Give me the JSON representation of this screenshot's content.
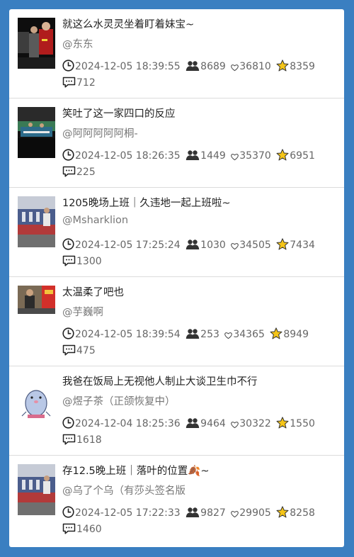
{
  "feed": {
    "items": [
      {
        "title": "就这么水灵灵坐着盯着妹宝~",
        "author": "@东东",
        "time": "2024-12-05 18:39:55",
        "viewers": "8689",
        "likes": "36810",
        "stars": "8359",
        "comments": "712",
        "thumb": "dark"
      },
      {
        "title": "笑吐了这一家四口的反应",
        "author": "@阿阿阿阿阿桐-",
        "time": "2024-12-05 18:26:35",
        "viewers": "1449",
        "likes": "35370",
        "stars": "6951",
        "comments": "225",
        "thumb": "court"
      },
      {
        "title": "1205晚场上班｜久违地一起上班啦~",
        "author": "@Msharklion",
        "time": "2024-12-05 17:25:24",
        "viewers": "1030",
        "likes": "34505",
        "stars": "7434",
        "comments": "1300",
        "thumb": "arena"
      },
      {
        "title": "太温柔了吧也",
        "author": "@芋巍啊",
        "time": "2024-12-05 18:39:54",
        "viewers": "253",
        "likes": "34365",
        "stars": "8949",
        "comments": "475",
        "thumb": "match"
      },
      {
        "title": "我爸在饭局上无视他人制止大谈卫生巾不行",
        "author": "@煜子茶（正颌恢复中）",
        "time": "2024-12-04 18:25:36",
        "viewers": "9464",
        "likes": "30322",
        "stars": "1550",
        "comments": "1618",
        "thumb": "cartoon"
      },
      {
        "title": "存12.5晚上班｜落叶的位置🍂~",
        "author": "@乌了个乌（有莎头签名版",
        "time": "2024-12-05 17:22:33",
        "viewers": "9827",
        "likes": "29905",
        "stars": "8258",
        "comments": "1460",
        "thumb": "arena"
      }
    ]
  }
}
